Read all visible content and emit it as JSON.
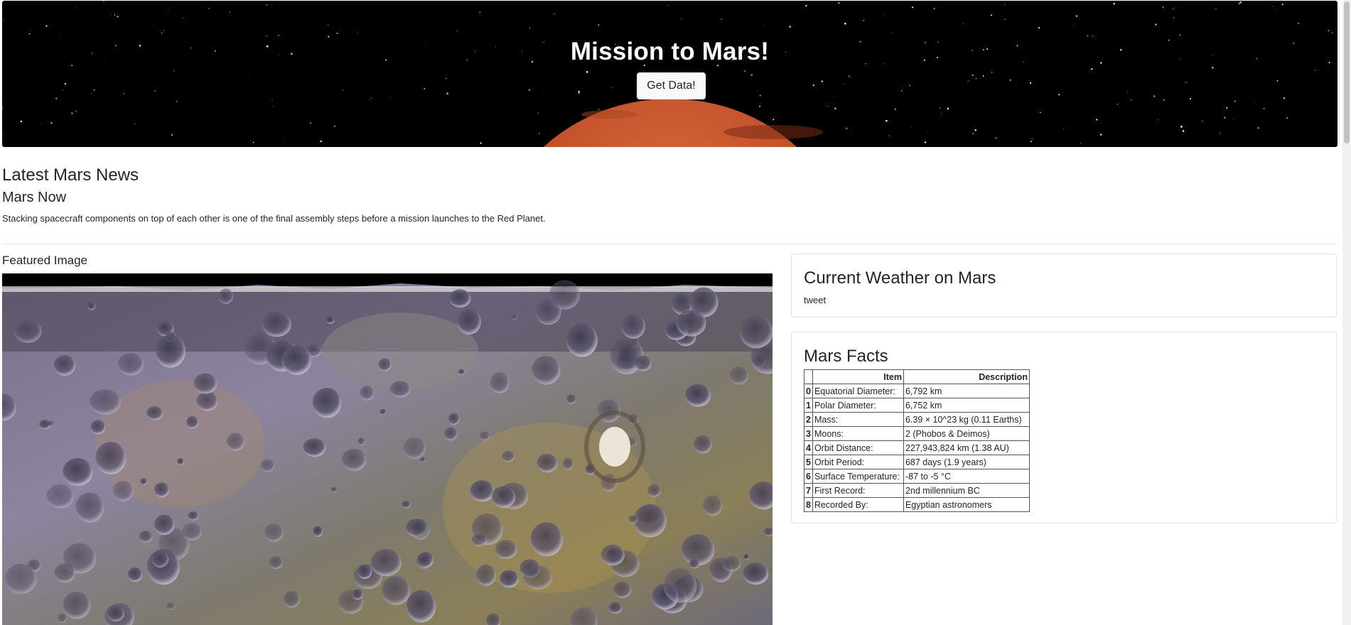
{
  "hero": {
    "title": "Mission to Mars!",
    "button_label": "Get Data!"
  },
  "news": {
    "heading": "Latest Mars News",
    "title": "Mars Now",
    "teaser": "Stacking spacecraft components on top of each other is one of the final assembly steps before a mission launches to the Red Planet."
  },
  "featured": {
    "label": "Featured Image"
  },
  "weather": {
    "title": "Current Weather on Mars",
    "text": "tweet"
  },
  "facts": {
    "title": "Mars Facts",
    "columns": [
      "",
      "Item",
      "Description"
    ],
    "rows": [
      {
        "index": "0",
        "item": "Equatorial Diameter:",
        "description": "6,792 km"
      },
      {
        "index": "1",
        "item": "Polar Diameter:",
        "description": "6,752 km"
      },
      {
        "index": "2",
        "item": "Mass:",
        "description": "6.39 × 10^23 kg (0.11 Earths)"
      },
      {
        "index": "3",
        "item": "Moons:",
        "description": "2 (Phobos & Deimos)"
      },
      {
        "index": "4",
        "item": "Orbit Distance:",
        "description": "227,943,824 km (1.38 AU)"
      },
      {
        "index": "5",
        "item": "Orbit Period:",
        "description": "687 days (1.9 years)"
      },
      {
        "index": "6",
        "item": "Surface Temperature:",
        "description": "-87 to -5 °C"
      },
      {
        "index": "7",
        "item": "First Record:",
        "description": "2nd millennium BC"
      },
      {
        "index": "8",
        "item": "Recorded By:",
        "description": "Egyptian astronomers"
      }
    ]
  },
  "colors": {
    "hero_bg": "#000000",
    "planet": "#c4532b",
    "text": "#212529",
    "border": "#dee2e6"
  }
}
